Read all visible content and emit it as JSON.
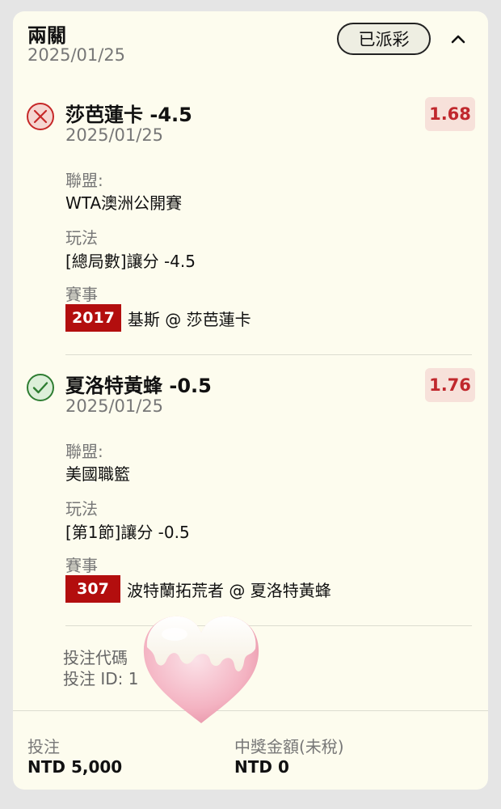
{
  "header": {
    "title": "兩關",
    "date": "2025/01/25",
    "status": "已派彩",
    "collapse_icon": "chevron-up-icon"
  },
  "bets": [
    {
      "result": "lost",
      "result_icon": "x-circle-icon",
      "team": "莎芭蓮卡 -4.5",
      "date": "2025/01/25",
      "odds": "1.68",
      "league_label": "聯盟:",
      "league": "WTA澳洲公開賽",
      "play_label": "玩法",
      "play": "[總局數]讓分 -4.5",
      "event_label": "賽事",
      "event_number": "2017",
      "event_name": "基斯 @ 莎芭蓮卡"
    },
    {
      "result": "won",
      "result_icon": "check-circle-icon",
      "team": "夏洛特黃蜂 -0.5",
      "date": "2025/01/25",
      "odds": "1.76",
      "league_label": "聯盟:",
      "league": "美國職籃",
      "play_label": "玩法",
      "play": "[第1節]讓分 -0.5",
      "event_label": "賽事",
      "event_number": "307",
      "event_name": "波特蘭拓荒者 @ 夏洛特黃蜂"
    }
  ],
  "bet_code": {
    "code_label": "投注代碼",
    "id_label": "投注 ID: 1"
  },
  "footer": {
    "stake_label": "投注",
    "stake_value": "NTD 5,000",
    "payout_label": "中獎金額(未稅)",
    "payout_value": "NTD 0"
  },
  "colors": {
    "card_background": "#fdfcee",
    "odds_text": "#c0282d",
    "odds_background": "#f7e1da",
    "event_badge": "#b30e0e",
    "lost_icon": "#c62828",
    "won_icon": "#2e7d32"
  },
  "sticker": "heart-sticker-icon"
}
